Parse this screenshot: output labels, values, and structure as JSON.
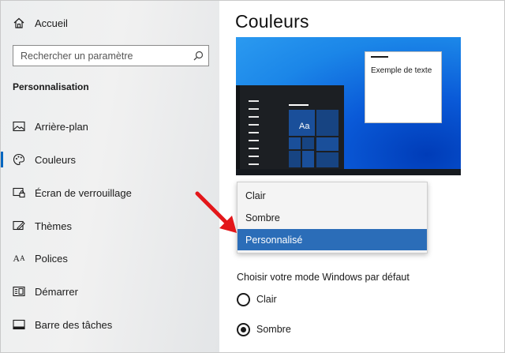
{
  "sidebar": {
    "home_label": "Accueil",
    "search_placeholder": "Rechercher un paramètre",
    "section_title": "Personnalisation",
    "items": [
      {
        "label": "Arrière-plan",
        "icon": "picture-icon"
      },
      {
        "label": "Couleurs",
        "icon": "palette-icon",
        "selected": true
      },
      {
        "label": "Écran de verrouillage",
        "icon": "lock-screen-icon"
      },
      {
        "label": "Thèmes",
        "icon": "themes-icon"
      },
      {
        "label": "Polices",
        "icon": "fonts-icon"
      },
      {
        "label": "Démarrer",
        "icon": "start-icon"
      },
      {
        "label": "Barre des tâches",
        "icon": "taskbar-icon"
      }
    ]
  },
  "main": {
    "title": "Couleurs",
    "preview": {
      "sample_text": "Exemple de texte",
      "tile_label": "Aa"
    },
    "dropdown": {
      "options": [
        "Clair",
        "Sombre",
        "Personnalisé"
      ],
      "selected_index": 2
    },
    "windows_mode": {
      "heading": "Choisir votre mode Windows par défaut",
      "options": [
        "Clair",
        "Sombre"
      ],
      "selected_index": 1
    }
  },
  "colors": {
    "accent": "#0067c0",
    "dropdown_selected": "#2b6db8",
    "annotation_arrow": "#e3161a"
  }
}
